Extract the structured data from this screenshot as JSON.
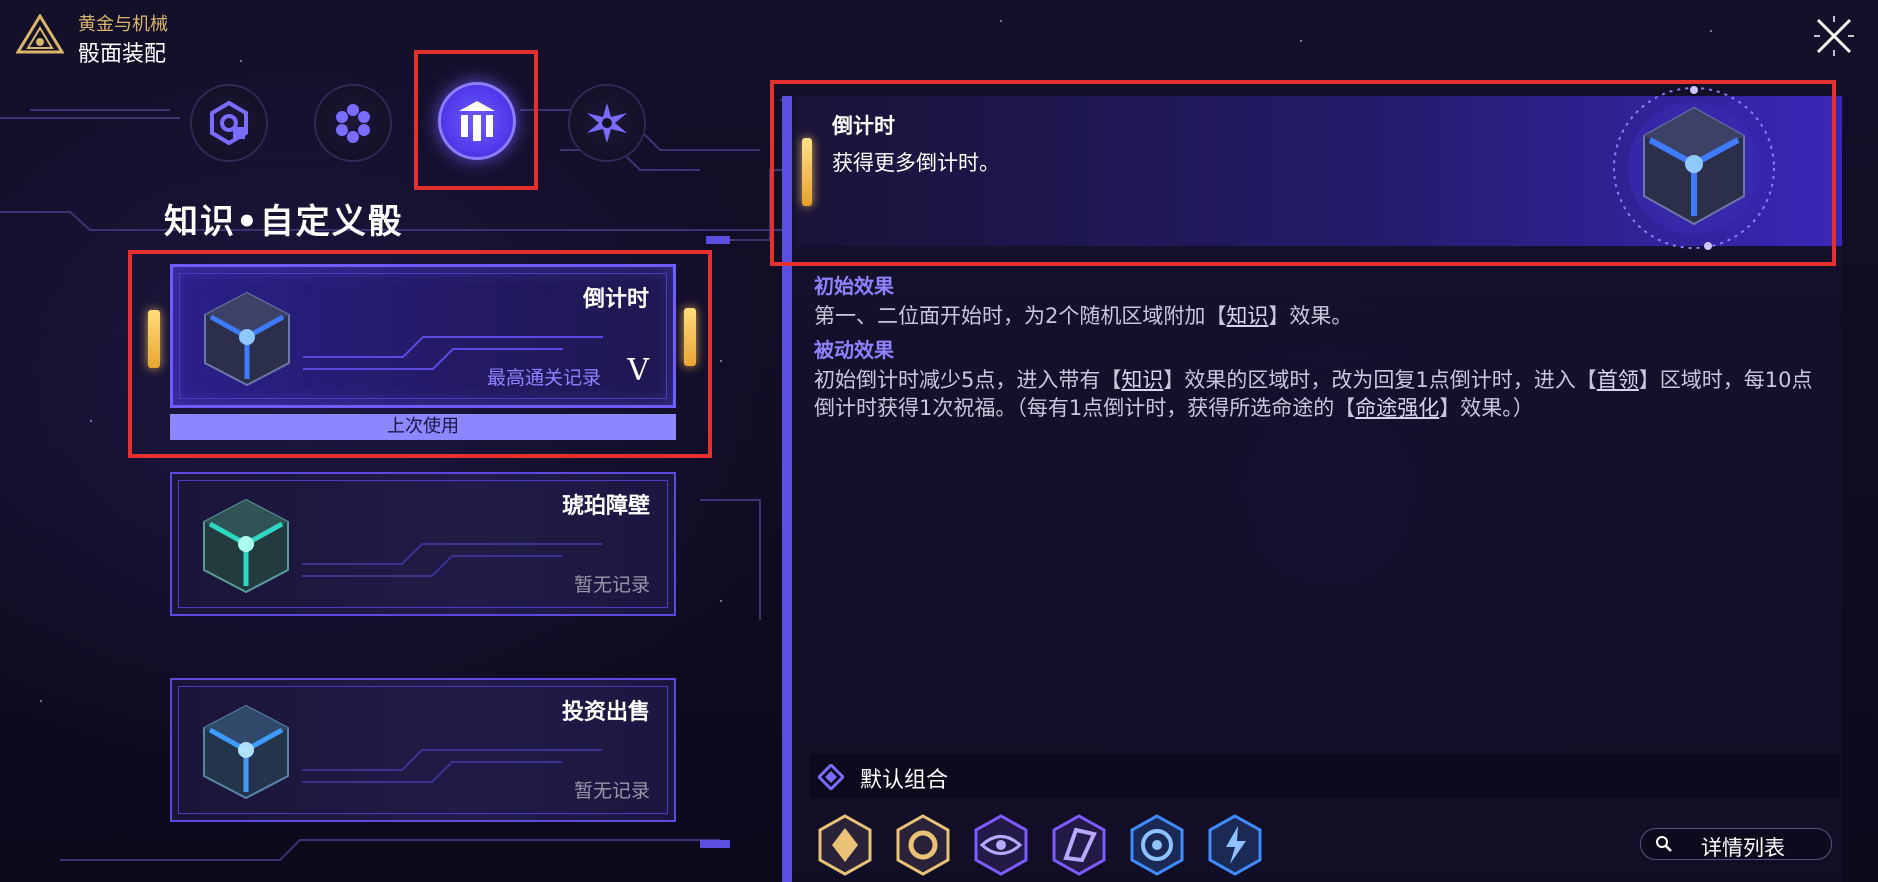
{
  "header": {
    "app_subtitle": "黄金与机械",
    "app_title": "骰面装配"
  },
  "tabs": [
    {
      "icon": "gear-hex-icon",
      "active": false
    },
    {
      "icon": "honeycomb-icon",
      "active": false
    },
    {
      "icon": "pillars-icon",
      "active": true
    },
    {
      "icon": "star-burst-icon",
      "active": false
    }
  ],
  "section_title": "知识•自定义骰",
  "cards": [
    {
      "name": "倒计时",
      "record": "最高通关记录",
      "rank": "V",
      "last_used": "上次使用",
      "cube_color": "#3e7bff"
    },
    {
      "name": "琥珀障壁",
      "record": "暂无记录",
      "cube_color": "#2fd6c2"
    },
    {
      "name": "投资出售",
      "record": "暂无记录",
      "cube_color": "#3e9bff"
    }
  ],
  "detail": {
    "name": "倒计时",
    "description": "获得更多倒计时。",
    "initial_effect_heading": "初始效果",
    "initial_effect": {
      "p1": "第一、二位面开始时，为2个随机区域附加【",
      "link1": "知识",
      "p2": "】效果。"
    },
    "passive_effect_heading": "被动效果",
    "passive_effect": {
      "p1": "初始倒计时减少5点，进入带有【",
      "link1": "知识",
      "p2": "】效果的区域时，改为回复1点倒计时，进入【",
      "link2": "首领",
      "p3": "】区域时，每10点倒计时获得1次祝福。（每有1点倒计时，获得所选命途的【",
      "link3": "命途强化",
      "p4": "】效果。）"
    }
  },
  "combo": {
    "title": "默认组合",
    "paths": [
      {
        "icon": "preservation-icon",
        "color": "#e9c277"
      },
      {
        "icon": "abundance-icon",
        "color": "#e9c277"
      },
      {
        "icon": "eye-icon",
        "color": "#7d5cff"
      },
      {
        "icon": "hunt-icon",
        "color": "#7d5cff"
      },
      {
        "icon": "ice-icon",
        "color": "#3f8cff"
      },
      {
        "icon": "lightning-icon",
        "color": "#3f8cff"
      }
    ],
    "details_button": "详情列表"
  },
  "colors": {
    "accent": "#6f5cff",
    "gold": "#d9b56a",
    "highlight": "#e4312f",
    "effect_heading": "#8f82ff"
  }
}
